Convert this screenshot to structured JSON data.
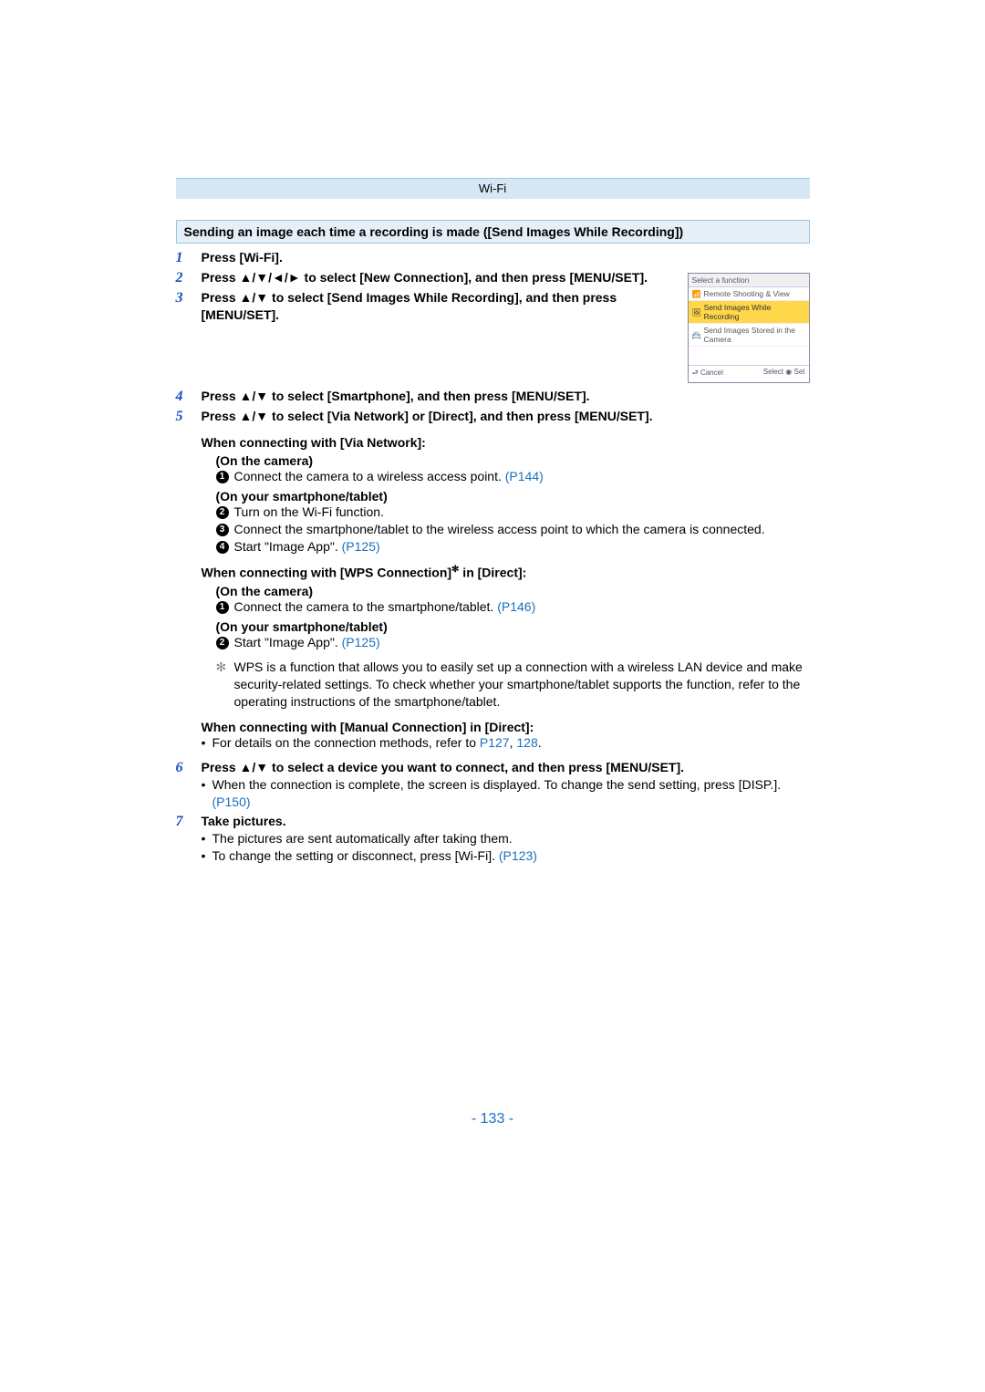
{
  "header": "Wi-Fi",
  "section_title": "Sending an image each time a recording is made ([Send Images While Recording])",
  "steps": {
    "s1": {
      "n": "1",
      "text": "Press [Wi-Fi]."
    },
    "s2": {
      "n": "2",
      "pre": "Press ",
      "arrows": "▲/▼/◄/►",
      "post": " to select [New Connection], and then press [MENU/SET]."
    },
    "s3": {
      "n": "3",
      "pre": "Press ",
      "arrows": "▲/▼",
      "post": " to select [Send Images While Recording], and then press [MENU/SET]."
    },
    "s4": {
      "n": "4",
      "pre": "Press ",
      "arrows": "▲/▼",
      "post": " to select [Smartphone], and then press [MENU/SET]."
    },
    "s5": {
      "n": "5",
      "pre": "Press ",
      "arrows": "▲/▼",
      "post": " to select [Via Network] or [Direct], and then press [MENU/SET]."
    },
    "s6": {
      "n": "6",
      "pre": "Press ",
      "arrows": "▲/▼",
      "post": " to select a device you want to connect, and then press [MENU/SET].",
      "note": "When the connection is complete, the screen is displayed. To change the send setting, press [DISP.]. ",
      "link": "(P150)"
    },
    "s7": {
      "n": "7",
      "text": "Take pictures.",
      "b1": "The pictures are sent automatically after taking them.",
      "b2_pre": "To change the setting or disconnect, press [Wi-Fi]. ",
      "b2_link": "(P123)"
    }
  },
  "sub": {
    "vn": {
      "h": "When connecting with [Via Network]:",
      "cam_h": "(On the camera)",
      "c1_text": "Connect the camera to a wireless access point. ",
      "c1_link": "(P144)",
      "sp_h": "(On your smartphone/tablet)",
      "c2": "Turn on the Wi-Fi function.",
      "c3": "Connect the smartphone/tablet to the wireless access point to which the camera is connected.",
      "c4_text": "Start \"Image App\". ",
      "c4_link": "(P125)"
    },
    "wps": {
      "h_pre": "When connecting with [WPS Connection]",
      "h_sup": "✻",
      "h_post": " in [Direct]:",
      "cam_h": "(On the camera)",
      "c1_text": "Connect the camera to the smartphone/tablet. ",
      "c1_link": "(P146)",
      "sp_h": "(On your smartphone/tablet)",
      "c2_text": "Start \"Image App\". ",
      "c2_link": "(P125)",
      "note": "WPS is a function that allows you to easily set up a connection with a wireless LAN device and make security-related settings. To check whether your smartphone/tablet supports the function, refer to the operating instructions of the smartphone/tablet."
    },
    "man": {
      "h": "When connecting with [Manual Connection] in [Direct]:",
      "note_pre": "For details on the connection methods, refer to ",
      "link1": "P127",
      "comma": ", ",
      "link2": "128",
      "dot": "."
    }
  },
  "cam": {
    "title": "Select a function",
    "i1": "Remote Shooting & View",
    "i2": "Send Images While Recording",
    "i3": "Send Images Stored in the Camera",
    "cancel": "Cancel",
    "select": "Select",
    "set": "Set"
  },
  "glyph": {
    "back": "⮐",
    "ok": "◉",
    "wifi": "📶",
    "img": "🖼",
    "sd": "📇",
    "ast": "✻"
  },
  "page_number": "- 133 -"
}
